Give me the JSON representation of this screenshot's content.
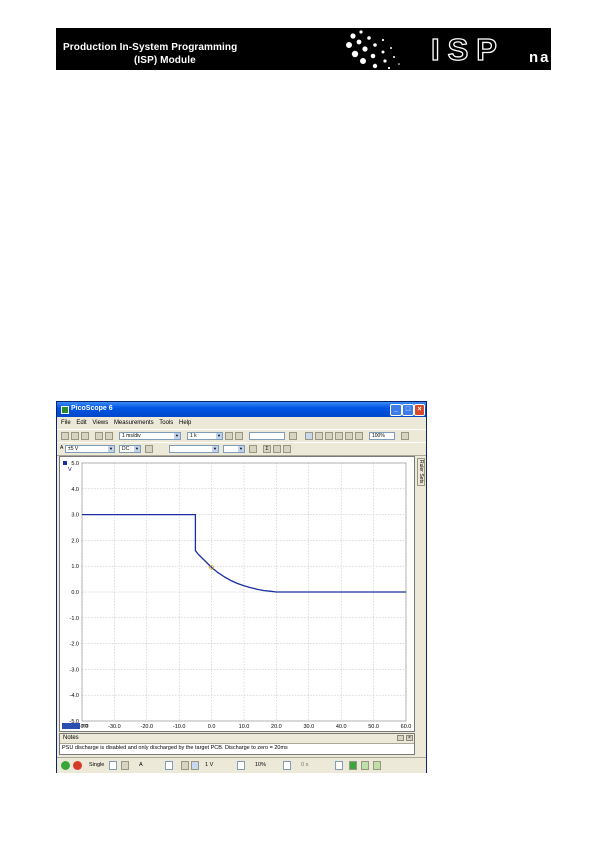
{
  "banner": {
    "line1": "Production In-System Programming",
    "line2": "(ISP) Module",
    "brand": "ISP",
    "product": "nano"
  },
  "window": {
    "title": "PicoScope 6",
    "menu": [
      "File",
      "Edit",
      "Views",
      "Measurements",
      "Tools",
      "Help"
    ],
    "toolbar": {
      "timebase": "1 ms/div",
      "samples": "1 k",
      "zoom": "100%",
      "channel_a_range": "±5 V",
      "coupling": "DC",
      "trigger_channel": "A"
    },
    "side_tab": "Ruler Sets"
  },
  "chart_data": {
    "type": "line",
    "y_unit": "V",
    "x_unit": "ms",
    "y_ticks": [
      "5.0",
      "4.0",
      "3.0",
      "2.0",
      "1.0",
      "0.0",
      "-1.0",
      "-2.0",
      "-3.0",
      "-4.0",
      "-5.0"
    ],
    "x_ticks": [
      "-40.0",
      "-30.0",
      "-20.0",
      "-10.0",
      "0.0",
      "10.0",
      "20.0",
      "30.0",
      "40.0",
      "50.0",
      "60.0"
    ],
    "xlim": [
      -40,
      60
    ],
    "ylim": [
      -5,
      5
    ],
    "grid": true,
    "series": [
      {
        "channel": "A",
        "color": "#1a2fa0",
        "x": [
          -40,
          -5,
          -5,
          -4,
          -2,
          0,
          2,
          4,
          6,
          8,
          10,
          12,
          14,
          16,
          18,
          20,
          60
        ],
        "y": [
          3.0,
          3.0,
          1.6,
          1.45,
          1.2,
          0.95,
          0.75,
          0.58,
          0.44,
          0.33,
          0.24,
          0.17,
          0.11,
          0.06,
          0.03,
          0.0,
          0.0
        ]
      }
    ],
    "trigger_marker": {
      "x": 0,
      "y": 0.95,
      "color": "#d8a800"
    }
  },
  "notes": {
    "header": "Notes",
    "text": "PSU discharge is disabled and only discharged by the target PCB.  Discharge to zero = 20ms"
  },
  "status": {
    "trigger_mode": "Single",
    "trigger_channel": "A",
    "threshold": "1 V",
    "pretrigger": "10%",
    "delay": "0 s"
  },
  "colors": {
    "banner_bg": "#000000",
    "title_bar": "#0055e5",
    "trace": "#1a2fa0"
  }
}
